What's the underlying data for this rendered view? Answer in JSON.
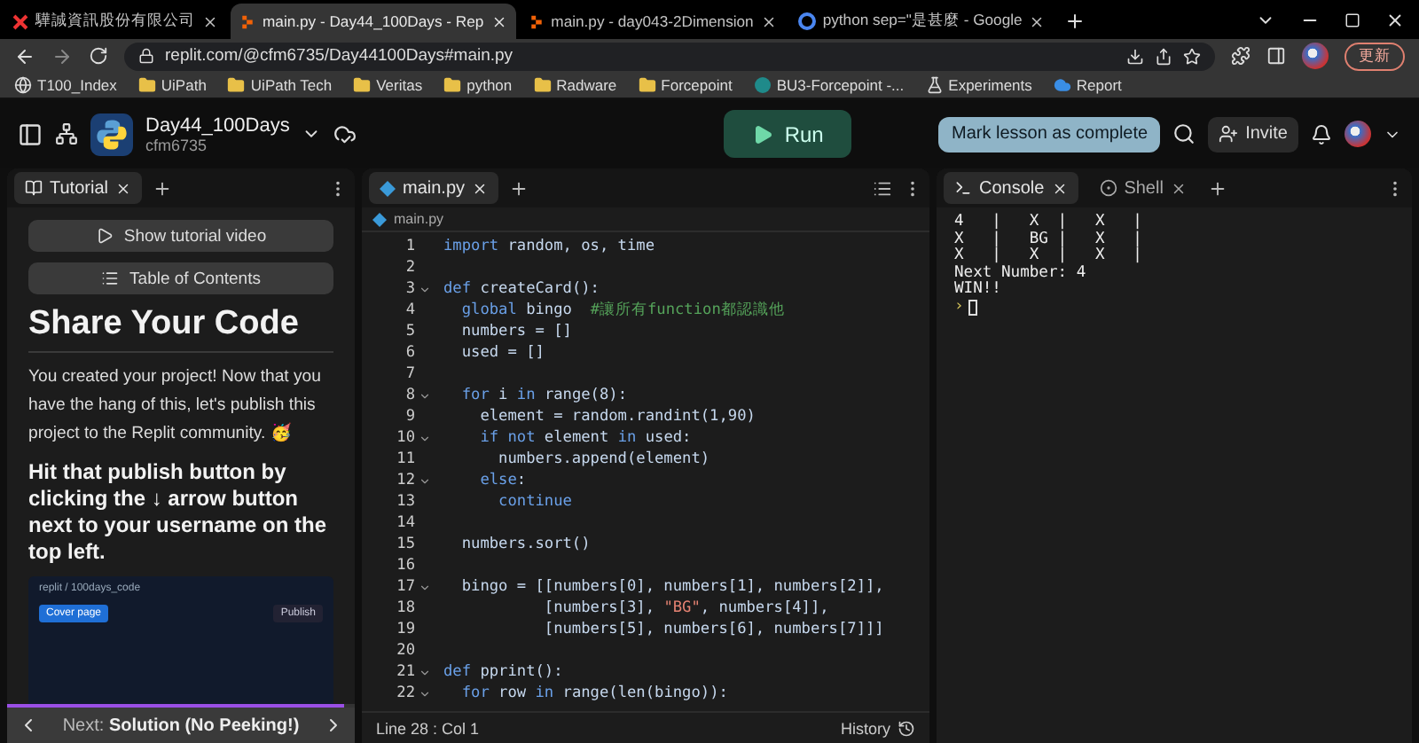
{
  "browser": {
    "tabs": [
      {
        "title": "驊誠資訊股份有限公司",
        "kind": "site",
        "selected": false
      },
      {
        "title": "main.py - Day44_100Days - Rep",
        "kind": "replit",
        "selected": true
      },
      {
        "title": "main.py - day043-2Dimension",
        "kind": "replit",
        "selected": false
      },
      {
        "title": "python sep=\"是甚麼 - Google",
        "kind": "google",
        "selected": false
      }
    ],
    "address": "replit.com/@cfm6735/Day44100Days#main.py",
    "update_button": "更新",
    "bookmarks": [
      {
        "label": "T100_Index",
        "kind": "globe"
      },
      {
        "label": "UiPath",
        "kind": "folder"
      },
      {
        "label": "UiPath Tech",
        "kind": "folder"
      },
      {
        "label": "Veritas",
        "kind": "folder"
      },
      {
        "label": "python",
        "kind": "folder"
      },
      {
        "label": "Radware",
        "kind": "folder"
      },
      {
        "label": "Forcepoint",
        "kind": "folder"
      },
      {
        "label": "BU3-Forcepoint -...",
        "kind": "site"
      },
      {
        "label": "Experiments",
        "kind": "flask"
      },
      {
        "label": "Report",
        "kind": "cloud"
      }
    ]
  },
  "header": {
    "project": "Day44_100Days",
    "owner": "cfm6735",
    "run_button": "Run",
    "mark_complete_button": "Mark lesson as complete",
    "invite_button": "Invite"
  },
  "tutorial": {
    "tabs": [
      {
        "label": "Tutorial",
        "selected": true
      }
    ],
    "video_button": "Show tutorial video",
    "toc_button": "Table of Contents",
    "title": "Share Your Code",
    "paragraph": "You created your project! Now that you have the hang of this, let's publish this project to the Replit community. 🥳",
    "instruction": "Hit that publish button by clicking the ↓ arrow button next to your username on the top left.",
    "screenshot": {
      "breadcrumb": "replit / 100days_code",
      "cover_button": "Cover page",
      "publish_button": "Publish"
    },
    "progress": {
      "level": 0.97
    },
    "next": {
      "prefix": "Next:",
      "title": "Solution (No Peeking!)"
    }
  },
  "editor": {
    "tabs": [
      {
        "label": "main.py",
        "selected": true
      }
    ],
    "file": "main.py",
    "lines": [
      {
        "number": "1",
        "fold": false,
        "tokens": [
          {
            "kind": "kw",
            "t": "import"
          },
          {
            "kind": "p",
            "t": " random, os, time"
          }
        ]
      },
      {
        "number": "2",
        "fold": false
      },
      {
        "number": "3",
        "fold": true,
        "tokens": [
          {
            "kind": "kw",
            "t": "def"
          },
          {
            "kind": "p",
            "t": " createCard():"
          }
        ]
      },
      {
        "number": "4",
        "fold": false,
        "tokens": [
          {
            "kind": "kw",
            "t": "  global"
          },
          {
            "kind": "p",
            "t": " bingo  "
          },
          {
            "kind": "comment",
            "t": "#讓所有function都認識他"
          }
        ]
      },
      {
        "number": "5",
        "fold": false,
        "tokens": [
          {
            "kind": "p",
            "t": "  numbers = []"
          }
        ]
      },
      {
        "number": "6",
        "fold": false,
        "tokens": [
          {
            "kind": "p",
            "t": "  used = []"
          }
        ]
      },
      {
        "number": "7",
        "fold": false
      },
      {
        "number": "8",
        "fold": true,
        "tokens": [
          {
            "kind": "kw",
            "t": "  for"
          },
          {
            "kind": "p",
            "t": " i "
          },
          {
            "kind": "kw",
            "t": "in"
          },
          {
            "kind": "p",
            "t": " range(8):"
          }
        ]
      },
      {
        "number": "9",
        "fold": false,
        "tokens": [
          {
            "kind": "p",
            "t": "    element = random.randint(1,90)"
          }
        ]
      },
      {
        "number": "10",
        "fold": true,
        "tokens": [
          {
            "kind": "kw",
            "t": "    if not"
          },
          {
            "kind": "p",
            "t": " element "
          },
          {
            "kind": "kw",
            "t": "in"
          },
          {
            "kind": "p",
            "t": " used:"
          }
        ]
      },
      {
        "number": "11",
        "fold": false,
        "tokens": [
          {
            "kind": "p",
            "t": "      numbers.append(element)"
          }
        ]
      },
      {
        "number": "12",
        "fold": true,
        "tokens": [
          {
            "kind": "kw",
            "t": "    else"
          },
          {
            "kind": "p",
            "t": ":"
          }
        ]
      },
      {
        "number": "13",
        "fold": false,
        "tokens": [
          {
            "kind": "kw",
            "t": "      continue"
          }
        ]
      },
      {
        "number": "14",
        "fold": false
      },
      {
        "number": "15",
        "fold": false,
        "tokens": [
          {
            "kind": "p",
            "t": "  numbers.sort()"
          }
        ]
      },
      {
        "number": "16",
        "fold": false
      },
      {
        "number": "17",
        "fold": true,
        "tokens": [
          {
            "kind": "p",
            "t": "  bingo = [[numbers[0], numbers[1], numbers[2]],"
          }
        ]
      },
      {
        "number": "18",
        "fold": false,
        "tokens": [
          {
            "kind": "p",
            "t": "           [numbers[3], "
          },
          {
            "kind": "string",
            "t": "\"BG\""
          },
          {
            "kind": "p",
            "t": ", numbers[4]],"
          }
        ]
      },
      {
        "number": "19",
        "fold": false,
        "tokens": [
          {
            "kind": "p",
            "t": "           [numbers[5], numbers[6], numbers[7]]]"
          }
        ]
      },
      {
        "number": "20",
        "fold": false
      },
      {
        "number": "21",
        "fold": true,
        "tokens": [
          {
            "kind": "kw",
            "t": "def"
          },
          {
            "kind": "p",
            "t": " pprint():"
          }
        ]
      },
      {
        "number": "22",
        "fold": true,
        "tokens": [
          {
            "kind": "kw",
            "t": "  for"
          },
          {
            "kind": "p",
            "t": " row "
          },
          {
            "kind": "kw",
            "t": "in"
          },
          {
            "kind": "p",
            "t": " range(len(bingo)):"
          }
        ]
      }
    ],
    "status": "Line 28 : Col 1",
    "history_button": "History"
  },
  "console": {
    "tabs": [
      {
        "label": "Console",
        "kind": "console",
        "selected": true
      },
      {
        "label": "Shell",
        "kind": "shell",
        "selected": false
      }
    ],
    "output": [
      "4   |   X  |   X   |",
      "X   |   BG |   X   |",
      "X   |   X  |   X   |",
      "Next Number: 4",
      "WIN!!"
    ],
    "prompt": "›"
  }
}
